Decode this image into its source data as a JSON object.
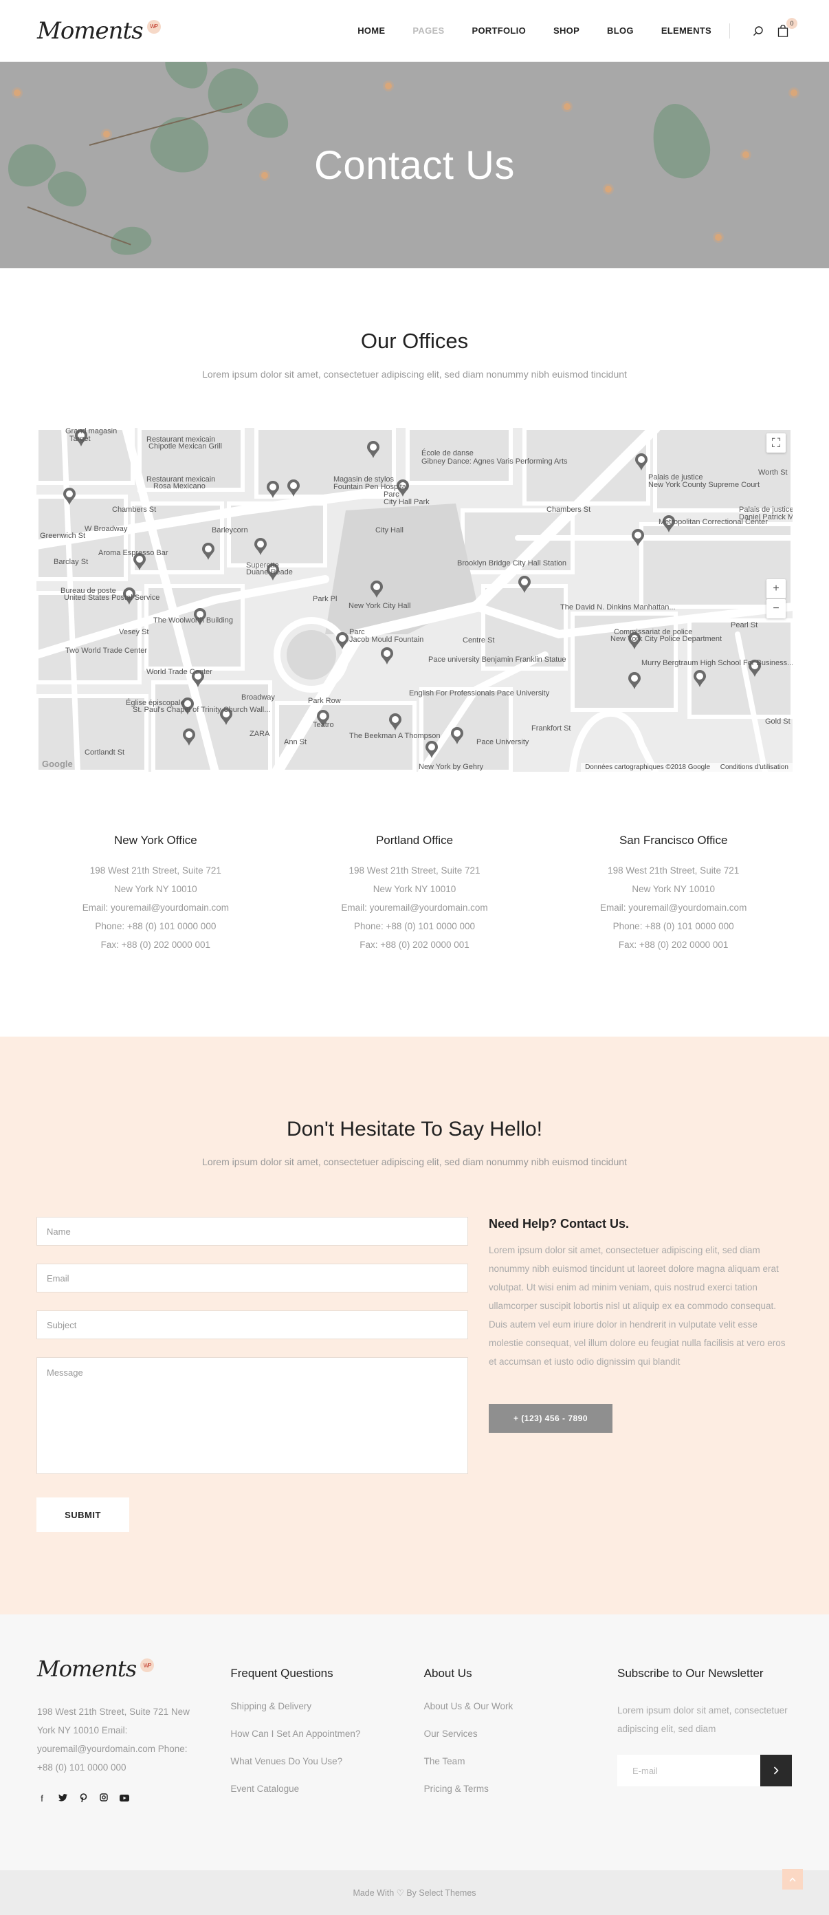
{
  "header": {
    "logo": "Moments",
    "logo_badge": "WP",
    "nav": [
      {
        "label": "HOME",
        "dim": false
      },
      {
        "label": "PAGES",
        "dim": true
      },
      {
        "label": "PORTFOLIO",
        "dim": false
      },
      {
        "label": "SHOP",
        "dim": false
      },
      {
        "label": "BLOG",
        "dim": false
      },
      {
        "label": "ELEMENTS",
        "dim": false
      }
    ],
    "cart_count": "0"
  },
  "hero": {
    "title": "Contact Us"
  },
  "offices": {
    "title": "Our Offices",
    "subtitle": "Lorem ipsum dolor sit amet, consectetuer adipiscing elit, sed diam nonummy nibh euismod tincidunt",
    "map": {
      "credit": "Données cartographiques ©2018 Google",
      "terms": "Conditions d'utilisation",
      "google": "Google",
      "zoom_in": "+",
      "zoom_out": "−",
      "labels": [
        "Grand magasin",
        "Target",
        "Restaurant mexicain",
        "Chipotle Mexican Grill",
        "École de danse",
        "Gibney Dance: Agnes Varis Performing Arts",
        "Magasin de stylos",
        "Fountain Pen Hospital",
        "Parc",
        "City Hall Park",
        "Chambers St",
        "Palais de justice",
        "New York County Supreme Court",
        "Restaurant mexicain",
        "Rosa Mexicano",
        "City Hall",
        "Barleycorn",
        "Metropolitan Correctional Center",
        "Palais de justice",
        "Daniel Patrick Moynihan US Courthouse",
        "Aroma Espresso Bar",
        "Superette",
        "Duane Reade",
        "Brooklyn Bridge City Hall Station",
        "Bureau de poste",
        "United States Postal Service",
        "New York City Hall",
        "The David N. Dinkins Manhattan...",
        "The Woolworth Building",
        "Commissariat de police",
        "New York City Police Department",
        "Two World Trade Center",
        "Parc",
        "Jacob Mould Fountain",
        "Pace university Benjamin Franklin Statue",
        "Murry Bergtraum High School For Business...",
        "World Trade Center",
        "Église épiscopale",
        "St. Paul's Chapel of Trinity Church Wall...",
        "Park Row",
        "English For Professionals Pace University",
        "ZARA",
        "Teatro",
        "The Beekman A Thompson",
        "Pace University",
        "Cortlandt St",
        "New York by Gehry",
        "Broadway",
        "Centre St",
        "Pearl St",
        "Vesey St",
        "Greenwich St",
        "W Broadway",
        "Barclay St",
        "Ann St",
        "Frankfort St",
        "Worth St",
        "Chambers St",
        "Park Pl",
        "Gold St"
      ]
    },
    "list": [
      {
        "name": "New York Office",
        "line1": "198 West 21th Street, Suite 721",
        "line2": "New York NY 10010",
        "email": "Email: youremail@yourdomain.com",
        "phone": "Phone: +88 (0) 101 0000 000",
        "fax": "Fax: +88 (0) 202 0000 001"
      },
      {
        "name": "Portland Office",
        "line1": "198 West 21th Street, Suite 721",
        "line2": "New York NY 10010",
        "email": "Email: youremail@yourdomain.com",
        "phone": "Phone: +88 (0) 101 0000 000",
        "fax": "Fax: +88 (0) 202 0000 001"
      },
      {
        "name": "San Francisco Office",
        "line1": "198 West 21th Street, Suite 721",
        "line2": "New York NY 10010",
        "email": "Email: youremail@yourdomain.com",
        "phone": "Phone: +88 (0) 101 0000 000",
        "fax": "Fax: +88 (0) 202 0000 001"
      }
    ]
  },
  "contact": {
    "title": "Don't Hesitate To Say Hello!",
    "subtitle": "Lorem ipsum dolor sit amet, consectetuer adipiscing elit, sed diam nonummy nibh euismod tincidunt",
    "form": {
      "name_placeholder": "Name",
      "email_placeholder": "Email",
      "subject_placeholder": "Subject",
      "message_placeholder": "Message",
      "submit": "SUBMIT"
    },
    "help": {
      "title": "Need Help? Contact Us.",
      "text": "Lorem ipsum dolor sit amet, consectetuer adipiscing elit, sed diam nonummy nibh euismod tincidunt ut laoreet dolore magna aliquam erat volutpat. Ut wisi enim ad minim veniam, quis nostrud exerci tation ullamcorper suscipit lobortis nisl ut aliquip ex ea commodo consequat. Duis autem vel eum iriure dolor in hendrerit in vulputate velit esse molestie consequat, vel illum dolore eu feugiat nulla facilisis at vero eros et accumsan et iusto odio dignissim qui blandit",
      "phone_button": "+ (123) 456 - 7890"
    }
  },
  "footer": {
    "logo": "Moments",
    "logo_badge": "WP",
    "address": "198 West 21th Street, Suite 721 New York NY 10010 Email: youremail@yourdomain.com Phone: +88 (0) 101 0000 000",
    "socials": [
      "facebook-icon",
      "twitter-icon",
      "pinterest-icon",
      "instagram-icon",
      "youtube-icon"
    ],
    "faq": {
      "title": "Frequent Questions",
      "links": [
        "Shipping & Delivery",
        "How Can I Set An Appointmen?",
        "What Venues Do You Use?",
        "Event Catalogue"
      ]
    },
    "about": {
      "title": "About Us",
      "links": [
        "About Us & Our Work",
        "Our Services",
        "The Team",
        "Pricing & Terms"
      ]
    },
    "newsletter": {
      "title": "Subscribe to Our Newsletter",
      "text": "Lorem ipsum dolor sit amet, consectetuer adipiscing elit, sed diam",
      "placeholder": "E-mail"
    },
    "bottom": "Made With ♡ By Select Themes"
  }
}
